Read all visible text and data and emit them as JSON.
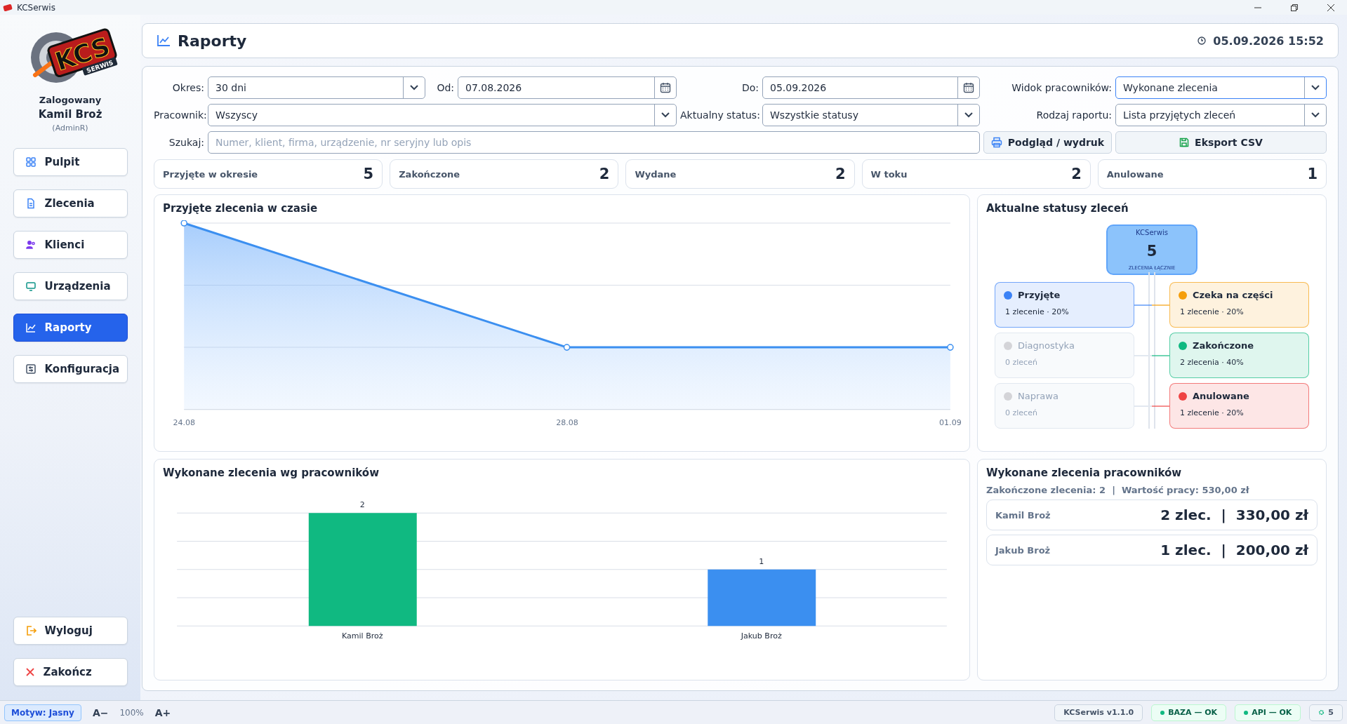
{
  "window": {
    "title": "KCSerwis"
  },
  "sidebar": {
    "logo": {
      "text": "KCS",
      "subtext": "SERWIS"
    },
    "user_caption": "Zalogowany",
    "user_name": "Kamil Broż",
    "user_role": "(AdminR)",
    "items": [
      {
        "label": "Pulpit",
        "selected": false
      },
      {
        "label": "Zlecenia",
        "selected": false
      },
      {
        "label": "Klienci",
        "selected": false
      },
      {
        "label": "Urządzenia",
        "selected": false
      },
      {
        "label": "Raporty",
        "selected": true
      },
      {
        "label": "Konfiguracja",
        "selected": false
      }
    ],
    "bottom_items": [
      {
        "label": "Wyloguj"
      },
      {
        "label": "Zakończ"
      }
    ]
  },
  "header": {
    "title": "Raporty",
    "datetime": "05.09.2026 15:52"
  },
  "filters": {
    "period": {
      "label": "Okres:",
      "value": "30 dni"
    },
    "from": {
      "label": "Od:",
      "value": "07.08.2026"
    },
    "to": {
      "label": "Do:",
      "value": "05.09.2026"
    },
    "employee_view": {
      "label": "Widok pracowników:",
      "value": "Wykonane zlecenia",
      "focused": true
    },
    "employee": {
      "label": "Pracownik:",
      "value": "Wszyscy"
    },
    "status": {
      "label": "Aktualny status:",
      "value": "Wszystkie statusy"
    },
    "report_type": {
      "label": "Rodzaj raportu:",
      "value": "Lista przyjętych zleceń"
    },
    "search": {
      "label": "Szukaj:",
      "placeholder": "Numer, klient, firma, urządzenie, nr seryjny lub opis"
    },
    "buttons": [
      "Podgląd / wydruk",
      "Eksport CSV"
    ]
  },
  "stats": [
    {
      "label": "Przyjęte w okresie",
      "value": "5"
    },
    {
      "label": "Zakończone",
      "value": "2"
    },
    {
      "label": "Wydane",
      "value": "2"
    },
    {
      "label": "W toku",
      "value": "2"
    },
    {
      "label": "Anulowane",
      "value": "1"
    }
  ],
  "timeline_chart": {
    "title": "Przyjęte zlecenia w czasie",
    "axis_labels": [
      "24.08",
      "28.08",
      "01.09"
    ]
  },
  "status_panel": {
    "title": "Aktualne statusy zleceń",
    "center": {
      "title": "KCSerwis",
      "total": "5",
      "caption": "ZLECENIA ŁĄCZNIE"
    },
    "statuses": [
      {
        "name": "Przyjęte",
        "count": "1 zlecenie · 20%",
        "color": "#3b82f6",
        "muted": false
      },
      {
        "name": "Czeka na części",
        "count": "1 zlecenie · 20%",
        "color": "#f59e0b",
        "muted": false
      },
      {
        "name": "Diagnostyka",
        "count": "0 zleceń",
        "color": "#d4d4d8",
        "muted": true
      },
      {
        "name": "Zakończone",
        "count": "2 zlecenia · 40%",
        "color": "#10b981",
        "muted": false
      },
      {
        "name": "Naprawa",
        "count": "0 zleceń",
        "color": "#d4d4d8",
        "muted": true
      },
      {
        "name": "Anulowane",
        "count": "1 zlecenie · 20%",
        "color": "#ef4444",
        "muted": false
      }
    ]
  },
  "employee_chart": {
    "title": "Wykonane zlecenia wg pracowników",
    "chart_data": {
      "type": "bar",
      "categories": [
        "Kamil Broż",
        "Jakub Broż"
      ],
      "values": [
        2,
        1
      ],
      "colors": [
        "#10b981",
        "#3b8ff0"
      ],
      "ylim": [
        0,
        2
      ],
      "data_labels": true
    }
  },
  "employee_summary": {
    "title": "Wykonane zlecenia pracowników",
    "summary": "Zakończone zlecenia: 2  |  Wartość pracy: 530,00 zł",
    "rows": [
      {
        "name": "Kamil Broż",
        "value": "2 zlec.  |  330,00 zł"
      },
      {
        "name": "Jakub Broż",
        "value": "1 zlec.  |  200,00 zł"
      }
    ]
  },
  "status_bar": {
    "theme": "Motyw: Jasny",
    "font_smaller": "A−",
    "zoom": "100%",
    "font_larger": "A+",
    "items": [
      {
        "label": "KCSerwis v1.1.0",
        "kind": "plain"
      },
      {
        "label": "BAZA — OK",
        "kind": "dot",
        "color": "#10b981"
      },
      {
        "label": "API — OK",
        "kind": "dot",
        "color": "#10b981"
      },
      {
        "label": "5",
        "kind": "icon"
      }
    ]
  }
}
